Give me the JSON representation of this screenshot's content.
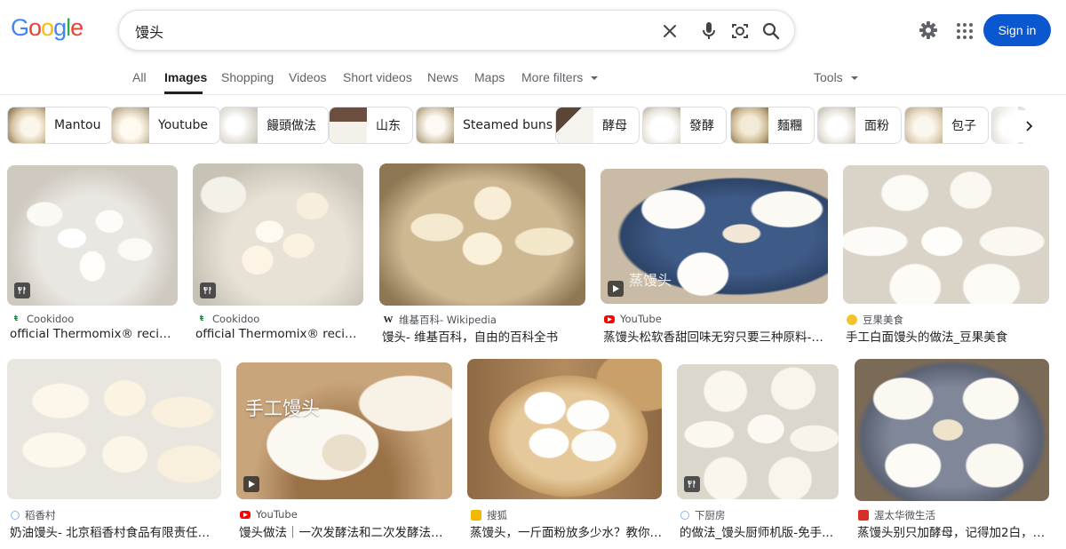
{
  "header": {
    "logo": [
      "G",
      "o",
      "o",
      "g",
      "l",
      "e"
    ],
    "logo_colors": [
      "#4285f4",
      "#ea4335",
      "#fbbc05",
      "#4285f4",
      "#34a853",
      "#ea4335"
    ],
    "search_value": "馒头",
    "sign_in_label": "Sign in"
  },
  "tabs": {
    "all": "All",
    "images": "Images",
    "shopping": "Shopping",
    "videos": "Videos",
    "short_videos": "Short videos",
    "news": "News",
    "maps": "Maps",
    "more_filters": "More filters",
    "tools": "Tools"
  },
  "chips": [
    "Mantou",
    "Youtube",
    "饅頭做法",
    "山东",
    "Steamed buns",
    "酵母",
    "發酵",
    "麵糰",
    "面粉",
    "包子"
  ],
  "results": [
    {
      "source": "Cookidoo",
      "title": "official Thermomix® recipe pl..."
    },
    {
      "source": "Cookidoo",
      "title": "official Thermomix® recipe pl..."
    },
    {
      "source": "维基百科- Wikipedia",
      "title": "馒头- 维基百科，自由的百科全书"
    },
    {
      "source": "YouTube",
      "title": "蒸馒头松软香甜回味无穷只要三种原料- Y..."
    },
    {
      "source": "豆果美食",
      "title": "手工白面馒头的做法_豆果美食"
    },
    {
      "source": "稻香村",
      "title": "奶油馒头- 北京稻香村食品有限责任公..."
    },
    {
      "source": "YouTube",
      "title": "馒头做法｜一次发酵法和二次发酵法的..."
    },
    {
      "source": "搜狐",
      "title": "蒸馒头，一斤面粉放多少水？教你3..."
    },
    {
      "source": "下厨房",
      "title": "的做法_馒头厨师机版-免手..."
    },
    {
      "source": "渥太华微生活",
      "title": "蒸馒头别只加酵母，记得加2白，馒..."
    }
  ],
  "overlay_text": {
    "r4": "蒸馒头",
    "r7": "手工馒头"
  },
  "colors": {
    "accent": "#0b57d0",
    "cookidoo": "#2b7f4a",
    "youtube": "#ff0000"
  }
}
